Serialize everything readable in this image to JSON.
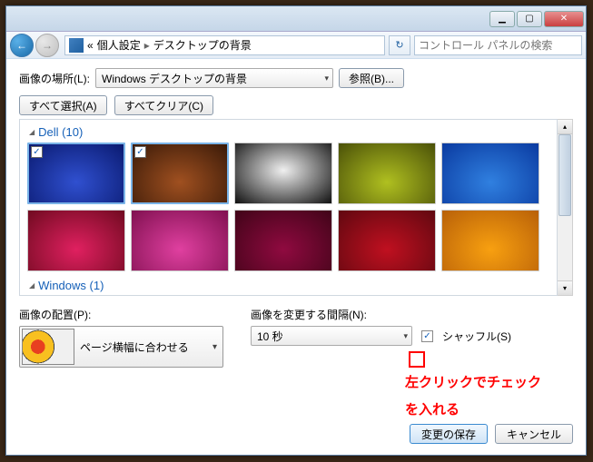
{
  "breadcrumb": {
    "root_chevrons": "«",
    "cat": "個人設定",
    "page": "デスクトップの背景"
  },
  "search": {
    "placeholder": "コントロール パネルの検索"
  },
  "loc": {
    "label": "画像の場所(L):",
    "value": "Windows デスクトップの背景",
    "browse": "参照(B)..."
  },
  "sel": {
    "all": "すべて選択(A)",
    "clear": "すべてクリア(C)"
  },
  "groups": {
    "dell": {
      "title": "Dell (10)"
    },
    "windows": {
      "title": "Windows (1)"
    }
  },
  "fit": {
    "label": "画像の配置(P):",
    "value": "ページ横幅に合わせる"
  },
  "interval": {
    "label": "画像を変更する間隔(N):",
    "value": "10 秒"
  },
  "shuffle": {
    "label": "シャッフル(S)",
    "checked": "✓"
  },
  "annotation": {
    "line1": "左クリックでチェック",
    "line2": "を入れる"
  },
  "footer": {
    "save": "変更の保存",
    "cancel": "キャンセル"
  },
  "winbtns": {
    "min": "▁",
    "max": "▢",
    "close": "✕"
  },
  "thumbs_dell_row1": [
    {
      "bg": "radial-gradient(ellipse at 50% 65%, #3050d0, #0a1a70)",
      "sel": true,
      "chk": "✓"
    },
    {
      "bg": "radial-gradient(ellipse at 50% 65%, #a05020, #3a1a08)",
      "sel": true,
      "chk": "✓"
    },
    {
      "bg": "radial-gradient(ellipse at 50% 45%, #f0f0f0, #101010)",
      "sel": false
    },
    {
      "bg": "radial-gradient(ellipse at 50% 65%, #b0c020, #4a5008)",
      "sel": false
    },
    {
      "bg": "radial-gradient(ellipse at 50% 65%, #3080e0, #0a3aa0)",
      "sel": false
    }
  ],
  "thumbs_dell_row2": [
    {
      "bg": "radial-gradient(ellipse at 50% 65%, #e02060, #700a20)"
    },
    {
      "bg": "radial-gradient(ellipse at 50% 65%, #e040a0, #801050)"
    },
    {
      "bg": "radial-gradient(ellipse at 50% 65%, #900a40, #400418)"
    },
    {
      "bg": "radial-gradient(ellipse at 50% 65%, #c01020, #600810)"
    },
    {
      "bg": "radial-gradient(ellipse at 50% 65%, #f8a010, #b86008)"
    }
  ]
}
